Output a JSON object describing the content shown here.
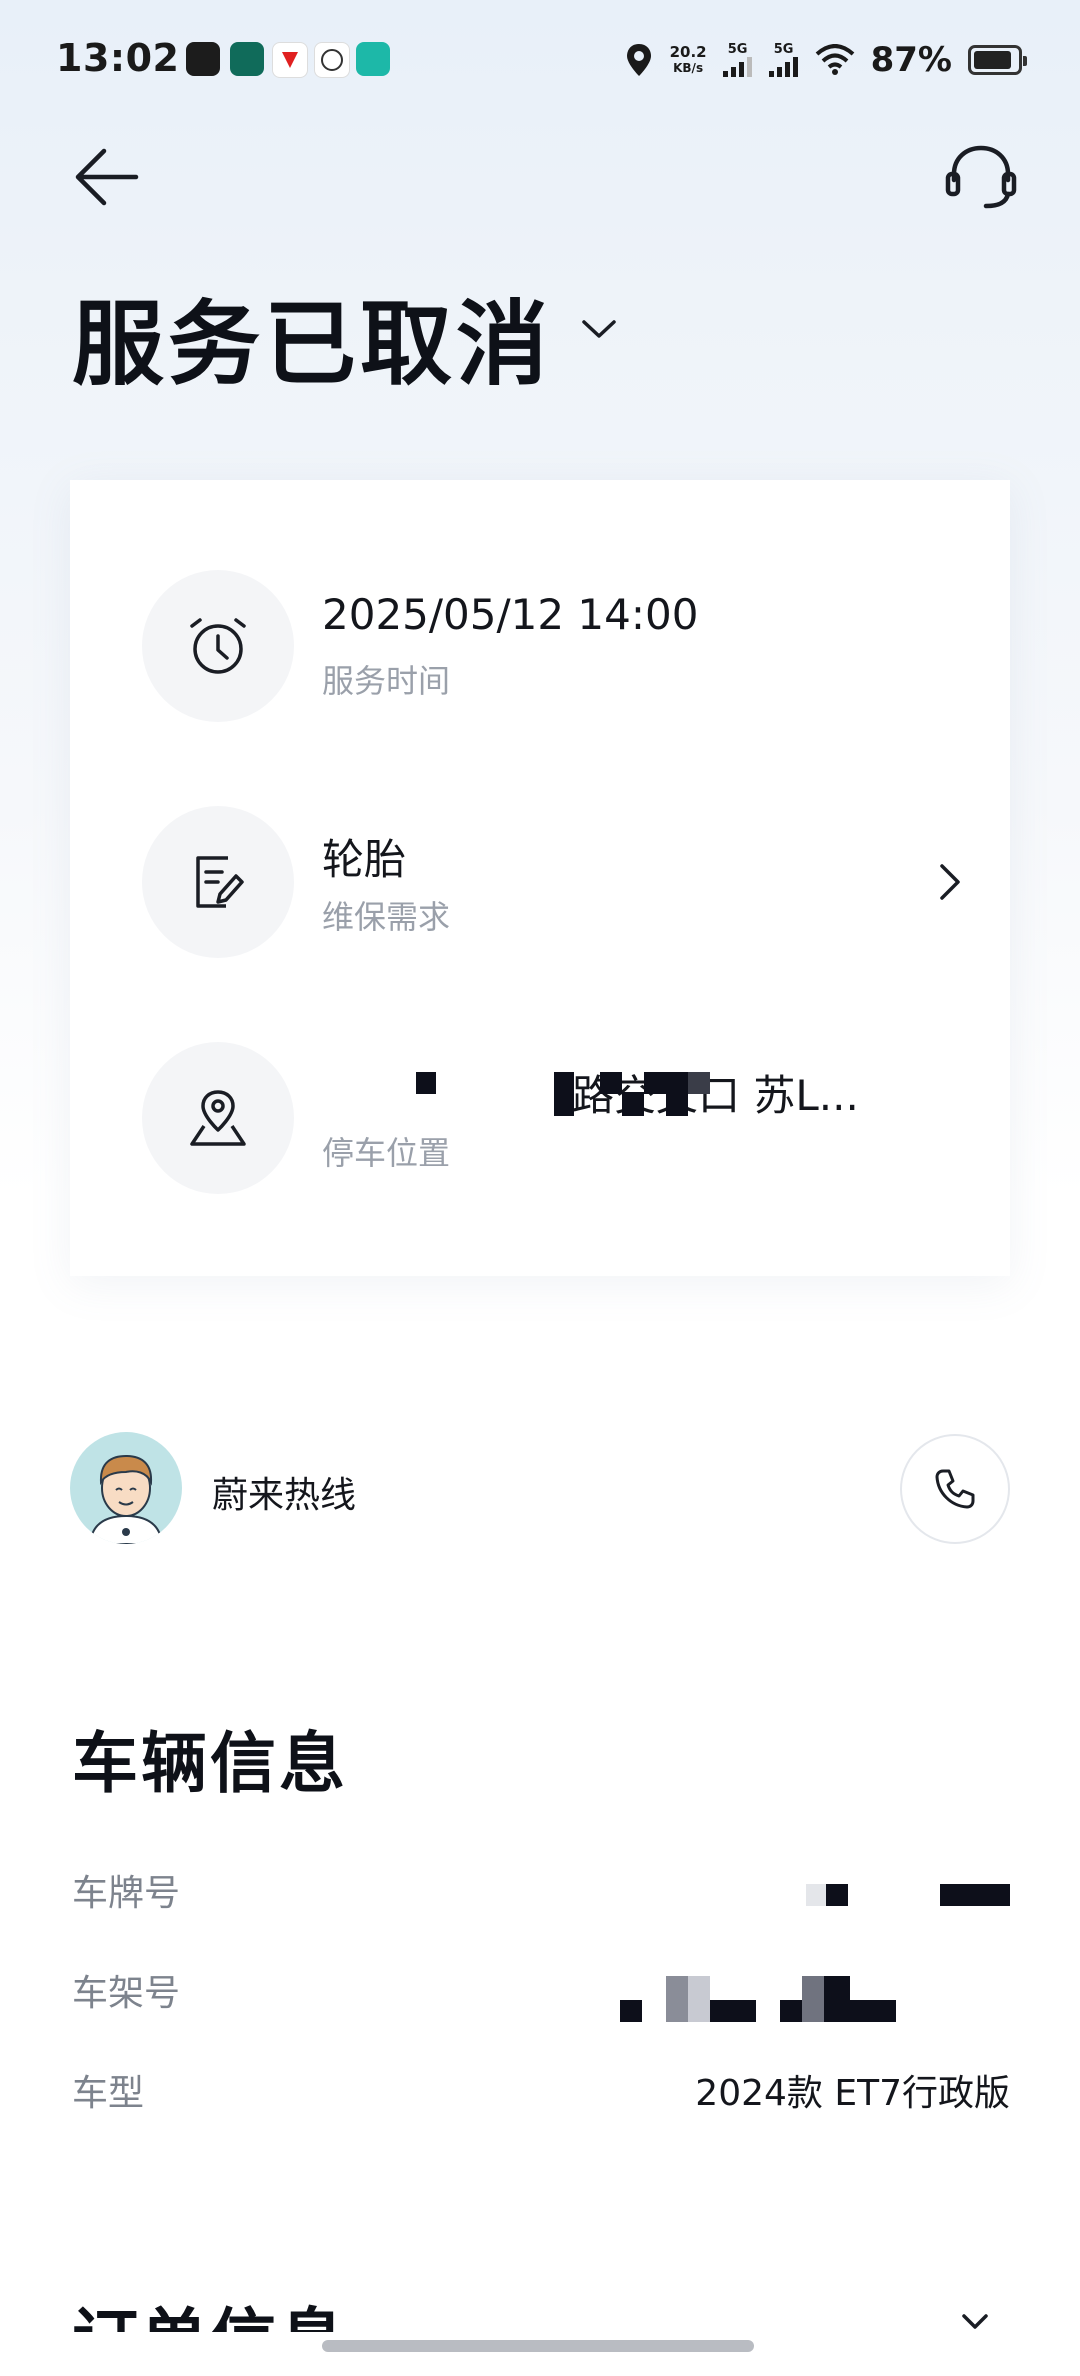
{
  "status_bar": {
    "time": "13:02",
    "net_speed_value": "20.2",
    "net_speed_unit": "KB/s",
    "sim1": "5G",
    "sim2": "5G",
    "battery": "87%",
    "battery_level": 0.87
  },
  "header": {
    "status_title": "服务已取消"
  },
  "service_card": {
    "time_value": "2025/05/12 14:00",
    "time_label": "服务时间",
    "need_value": "轮胎",
    "need_label": "维保需求",
    "location_value": "路交叉口 苏L...",
    "location_label": "停车位置"
  },
  "hotline": {
    "label": "蔚来热线"
  },
  "vehicle_info": {
    "title": "车辆信息",
    "plate_label": "车牌号",
    "vin_label": "车架号",
    "model_label": "车型",
    "model_value": "2024款 ET7行政版"
  },
  "order_info": {
    "title": "订单信息"
  },
  "colors": {
    "accent_text": "#0e1118",
    "secondary_text": "#9aa0aa",
    "icon_bg": "#f4f5f7"
  },
  "icons": [
    "back-arrow-icon",
    "headset-icon",
    "chevron-down-icon",
    "alarm-clock-icon",
    "edit-document-icon",
    "chevron-right-icon",
    "location-map-icon",
    "phone-icon"
  ]
}
